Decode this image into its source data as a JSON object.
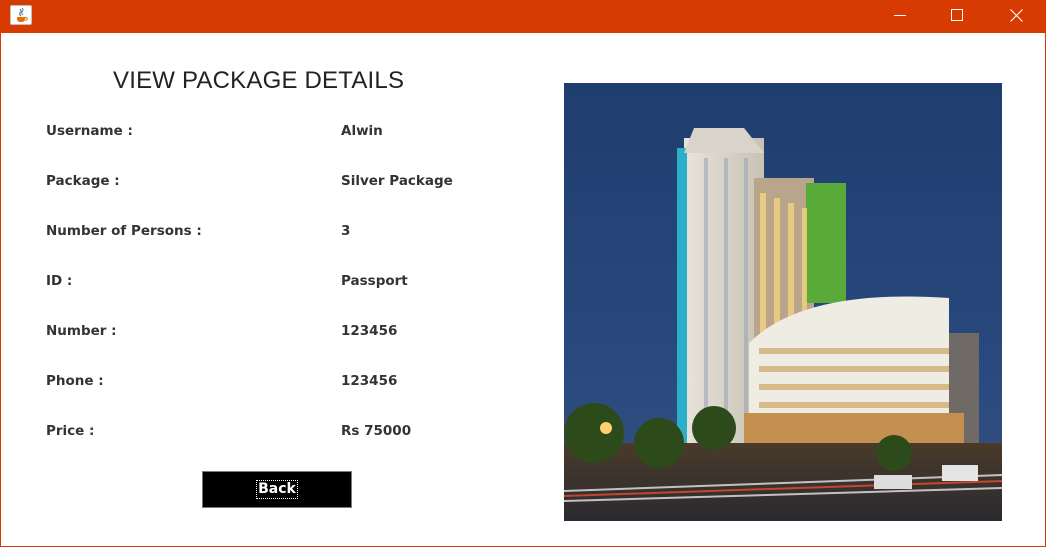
{
  "window": {
    "controls": {
      "minimize_icon": "minimize-icon",
      "maximize_icon": "maximize-icon",
      "close_icon": "close-icon"
    },
    "titlebar_color": "#d83b01"
  },
  "page": {
    "heading": "VIEW PACKAGE DETAILS",
    "details": [
      {
        "label": "Username :",
        "value": "Alwin"
      },
      {
        "label": "Package :",
        "value": "Silver Package"
      },
      {
        "label": "Number of Persons :",
        "value": "3"
      },
      {
        "label": "ID :",
        "value": "Passport"
      },
      {
        "label": "Number :",
        "value": "123456"
      },
      {
        "label": "Phone :",
        "value": "123456"
      },
      {
        "label": "Price :",
        "value": "Rs 75000"
      }
    ],
    "back_button": "Back"
  }
}
